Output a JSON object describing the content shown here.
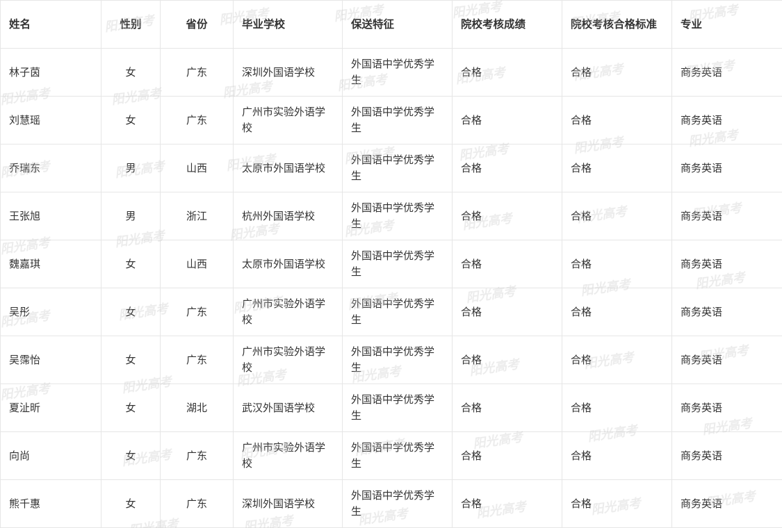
{
  "table": {
    "headers": [
      "姓名",
      "性别",
      "省份",
      "毕业学校",
      "保送特征",
      "院校考核成绩",
      "院校考核合格标准",
      "专业"
    ],
    "rows": [
      [
        "林子茵",
        "女",
        "广东",
        "深圳外国语学校",
        "外国语中学优秀学生",
        "合格",
        "合格",
        "商务英语"
      ],
      [
        "刘慧瑶",
        "女",
        "广东",
        "广州市实验外语学校",
        "外国语中学优秀学生",
        "合格",
        "合格",
        "商务英语"
      ],
      [
        "乔瑞东",
        "男",
        "山西",
        "太原市外国语学校",
        "外国语中学优秀学生",
        "合格",
        "合格",
        "商务英语"
      ],
      [
        "王张旭",
        "男",
        "浙江",
        "杭州外国语学校",
        "外国语中学优秀学生",
        "合格",
        "合格",
        "商务英语"
      ],
      [
        "魏嘉琪",
        "女",
        "山西",
        "太原市外国语学校",
        "外国语中学优秀学生",
        "合格",
        "合格",
        "商务英语"
      ],
      [
        "吴彤",
        "女",
        "广东",
        "广州市实验外语学校",
        "外国语中学优秀学生",
        "合格",
        "合格",
        "商务英语"
      ],
      [
        "吴霈怡",
        "女",
        "广东",
        "广州市实验外语学校",
        "外国语中学优秀学生",
        "合格",
        "合格",
        "商务英语"
      ],
      [
        "夏沚昕",
        "女",
        "湖北",
        "武汉外国语学校",
        "外国语中学优秀学生",
        "合格",
        "合格",
        "商务英语"
      ],
      [
        "向尚",
        "女",
        "广东",
        "广州市实验外语学校",
        "外国语中学优秀学生",
        "合格",
        "合格",
        "商务英语"
      ],
      [
        "熊千惠",
        "女",
        "广东",
        "深圳外国语学校",
        "外国语中学优秀学生",
        "合格",
        "合格",
        "商务英语"
      ]
    ]
  },
  "watermark": {
    "text": "阳光高考",
    "color": "#c8c8c8"
  }
}
